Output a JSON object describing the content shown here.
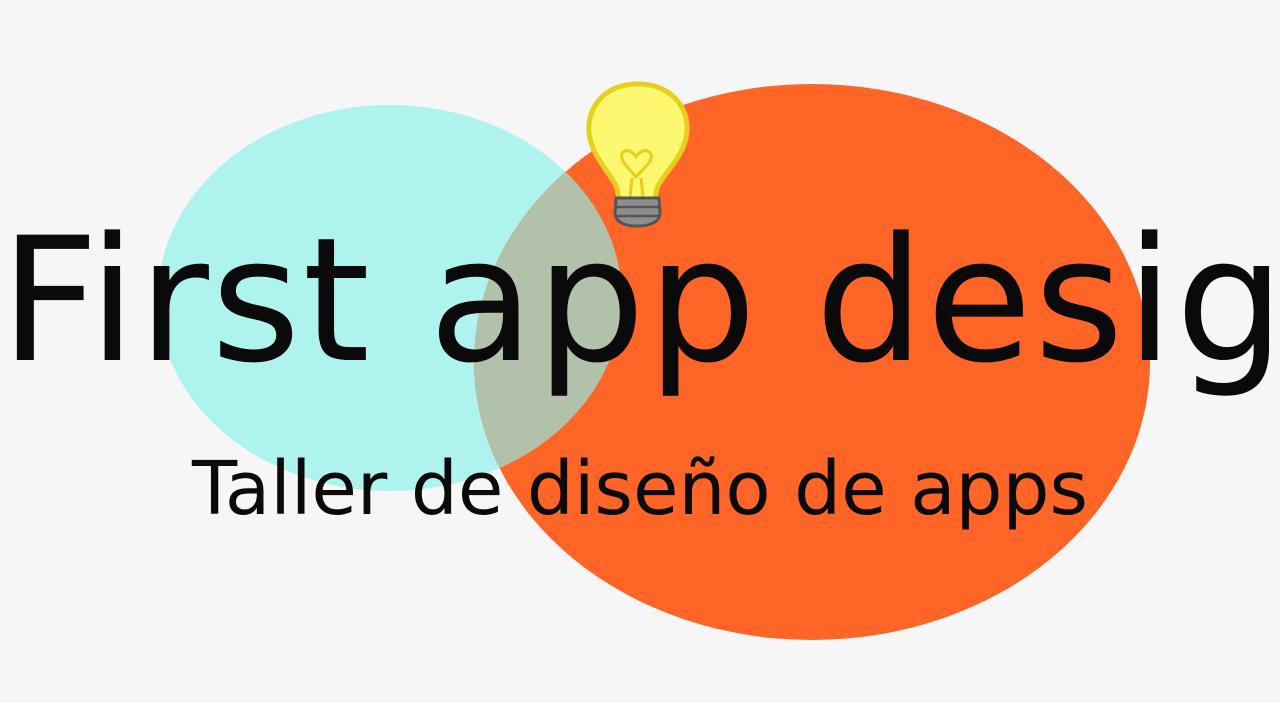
{
  "logo": {
    "title": "First app design",
    "subtitle": "Taller de diseño de apps",
    "icon": "lightbulb-icon",
    "colors": {
      "background": "#f6f6f6",
      "left_circle": "#aff3ee",
      "right_circle": "#fe6527",
      "overlap": "#b2c1a9",
      "bulb_glass": "#fdf870",
      "bulb_outline": "#e8cf1d",
      "bulb_base": "#8e8e8e",
      "text": "#0a0a0a"
    }
  }
}
